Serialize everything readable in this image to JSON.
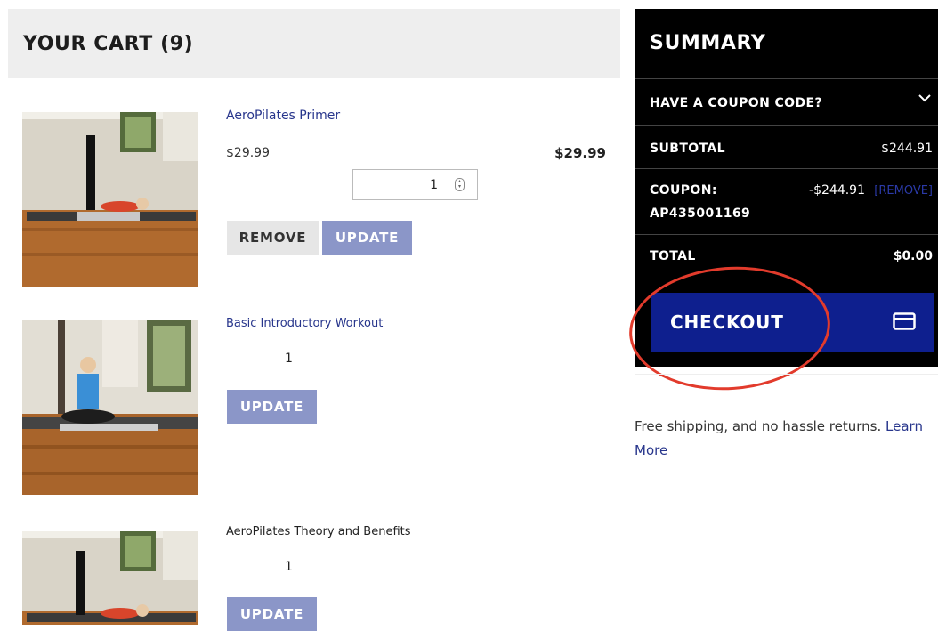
{
  "cart": {
    "title": "YOUR CART (9)",
    "items": [
      {
        "name": "AeroPilates Primer",
        "price": "$29.99",
        "line_total": "$29.99",
        "quantity": "1",
        "remove_label": "REMOVE",
        "update_label": "UPDATE"
      },
      {
        "name": "Basic Introductory Workout",
        "quantity": "1",
        "update_label": "UPDATE"
      },
      {
        "name": "AeroPilates Theory and Benefits",
        "quantity": "1",
        "update_label": "UPDATE"
      }
    ]
  },
  "summary": {
    "title": "SUMMARY",
    "coupon_toggle": "HAVE A COUPON CODE?",
    "subtotal_label": "SUBTOTAL",
    "subtotal_value": "$244.91",
    "coupon_label": "COUPON:",
    "coupon_code": "AP435001169",
    "coupon_value": "-$244.91",
    "coupon_remove": "[REMOVE]",
    "total_label": "TOTAL",
    "total_value": "$0.00",
    "checkout_label": "CHECKOUT"
  },
  "shipping": {
    "text": "Free shipping, and no hassle returns.",
    "link": "Learn More"
  },
  "colors": {
    "checkout_bg": "#0e1f8e",
    "update_bg": "#8b96c8",
    "link": "#28368c",
    "annotation_circle": "#e23b2c"
  }
}
